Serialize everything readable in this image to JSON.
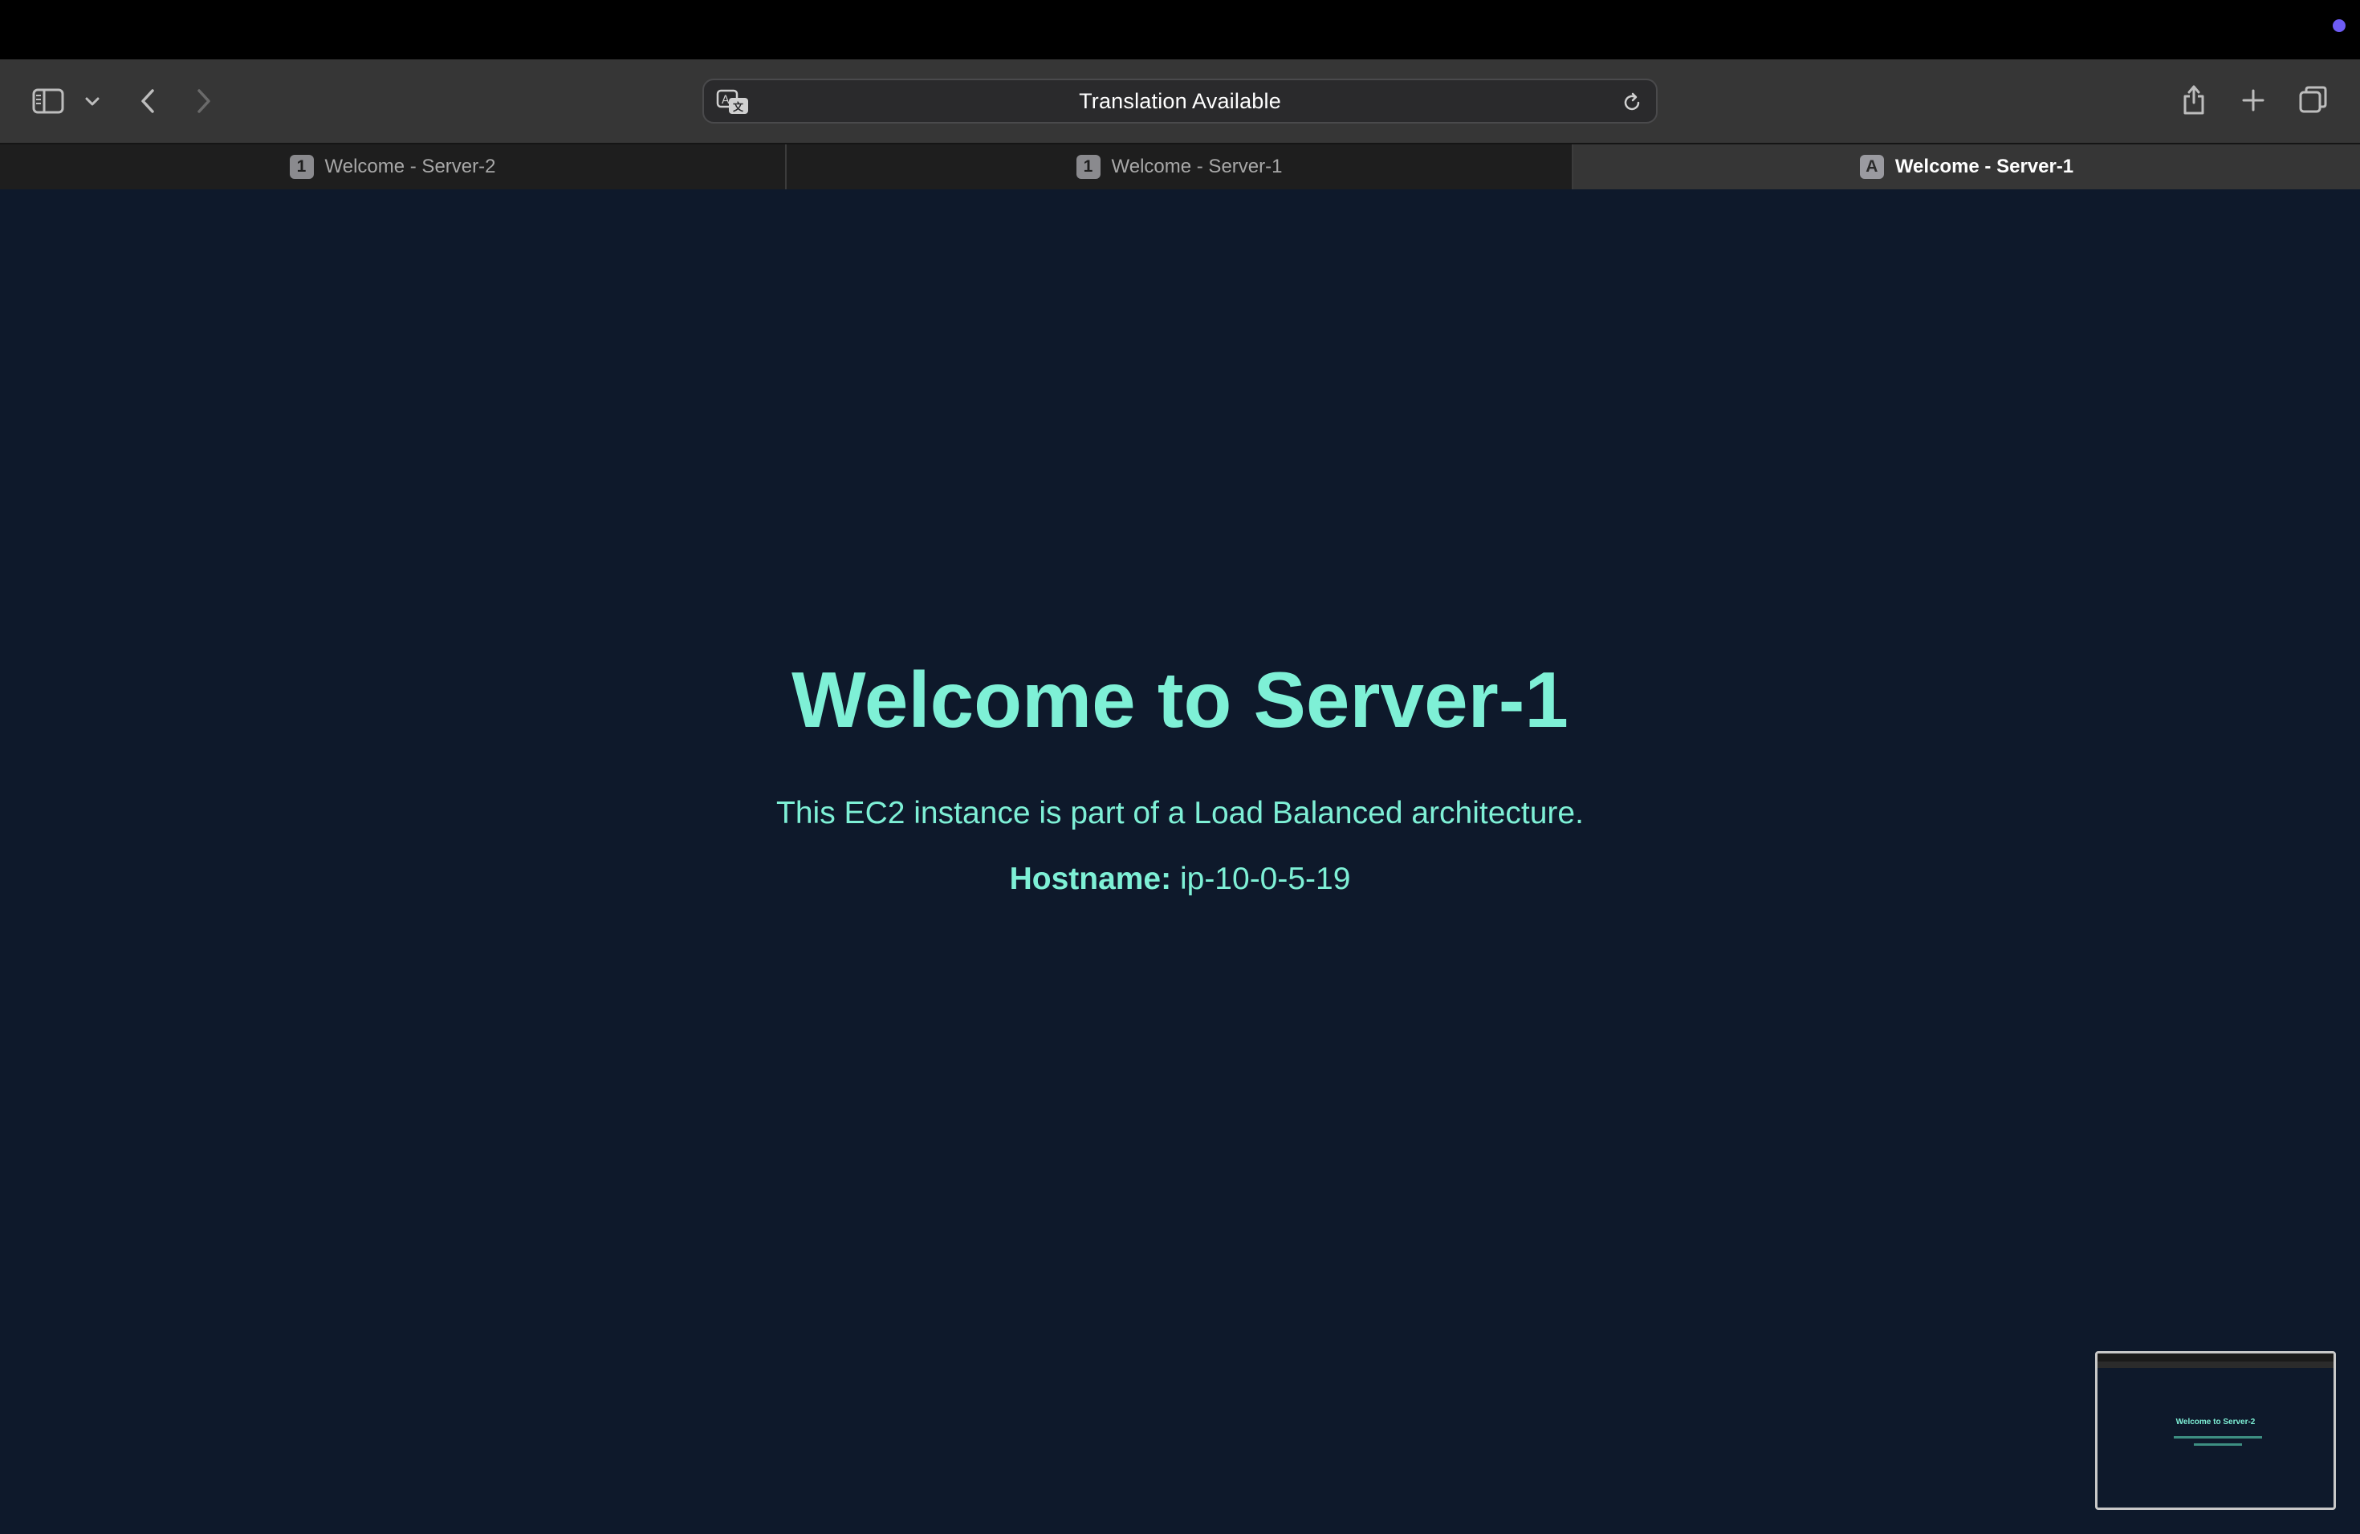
{
  "browser": {
    "address_bar": {
      "text": "Translation Available",
      "translate_icon": "translate-icon",
      "reload_icon": "reload-icon"
    },
    "toolbar_icons": [
      "sidebar-icon",
      "chevron-down-icon",
      "back-icon",
      "forward-icon",
      "share-icon",
      "plus-icon",
      "tabs-overview-icon"
    ],
    "tabs": [
      {
        "badge": "1",
        "title": "Welcome - Server-2",
        "active": false
      },
      {
        "badge": "1",
        "title": "Welcome - Server-1",
        "active": false
      },
      {
        "badge": "A",
        "title": "Welcome - Server-1",
        "active": true
      }
    ],
    "status_dot_color": "#6e5cf5"
  },
  "page": {
    "heading": "Welcome to Server-1",
    "subtitle": "This EC2 instance is part of a Load Balanced architecture.",
    "hostname_label": "Hostname:",
    "hostname_value": "ip-10-0-5-19",
    "thumbnail_heading": "Welcome to Server-2"
  },
  "colors": {
    "background": "#0e192b",
    "accent_text": "#7ef0d6",
    "toolbar": "#363636"
  }
}
